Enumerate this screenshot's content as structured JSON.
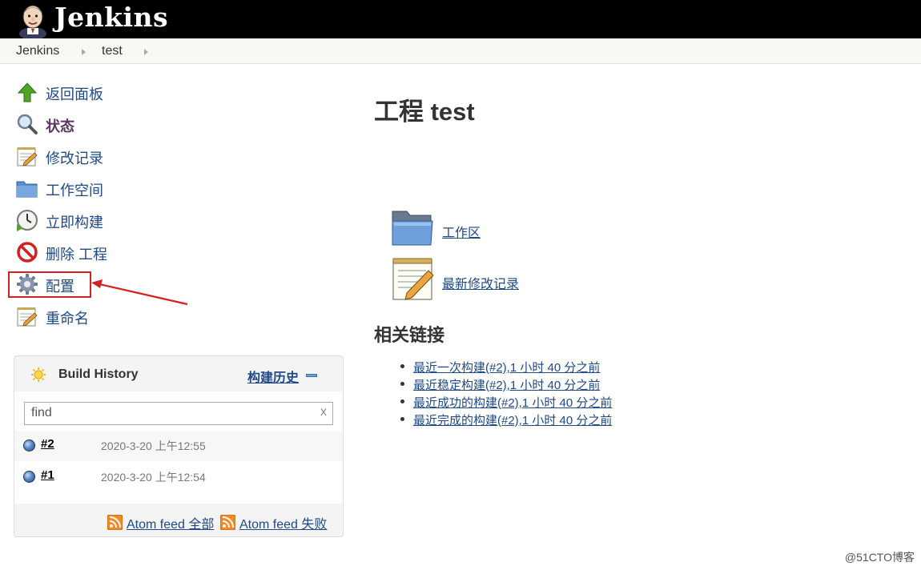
{
  "header": {
    "logo_text": "Jenkins"
  },
  "breadcrumb": {
    "items": [
      "Jenkins",
      "test"
    ]
  },
  "sidebar": {
    "tasks": [
      {
        "label": "返回面板",
        "icon": "up-arrow-icon"
      },
      {
        "label": "状态",
        "icon": "magnifier-icon",
        "current": true
      },
      {
        "label": "修改记录",
        "icon": "notepad-icon"
      },
      {
        "label": "工作空间",
        "icon": "folder-icon"
      },
      {
        "label": "立即构建",
        "icon": "clock-icon"
      },
      {
        "label": "删除 工程",
        "icon": "no-entry-icon"
      },
      {
        "label": "配置",
        "icon": "gear-icon"
      },
      {
        "label": "重命名",
        "icon": "notepad-icon"
      }
    ]
  },
  "build_history": {
    "title": "Build History",
    "trend_label": "构建历史",
    "search_placeholder": "find",
    "search_clear": "x",
    "builds": [
      {
        "number": "#2",
        "date": "2020-3-20 上午12:55"
      },
      {
        "number": "#1",
        "date": "2020-3-20 上午12:54"
      }
    ],
    "feeds": {
      "all": "Atom feed 全部",
      "failures": "Atom feed 失败"
    }
  },
  "main": {
    "title": "工程 test",
    "links": {
      "workspace": "工作区",
      "changes": "最新修改记录"
    },
    "related_title": "相关链接",
    "permalinks": [
      "最近一次构建(#2),1 小时 40 分之前",
      "最近稳定构建(#2),1 小时 40 分之前",
      "最近成功的构建(#2),1 小时 40 分之前",
      "最近完成的构建(#2),1 小时 40 分之前"
    ]
  },
  "watermark": "@51CTO博客",
  "colors": {
    "header_bg": "#000000",
    "link": "#204a87",
    "highlight": "#d42020"
  }
}
